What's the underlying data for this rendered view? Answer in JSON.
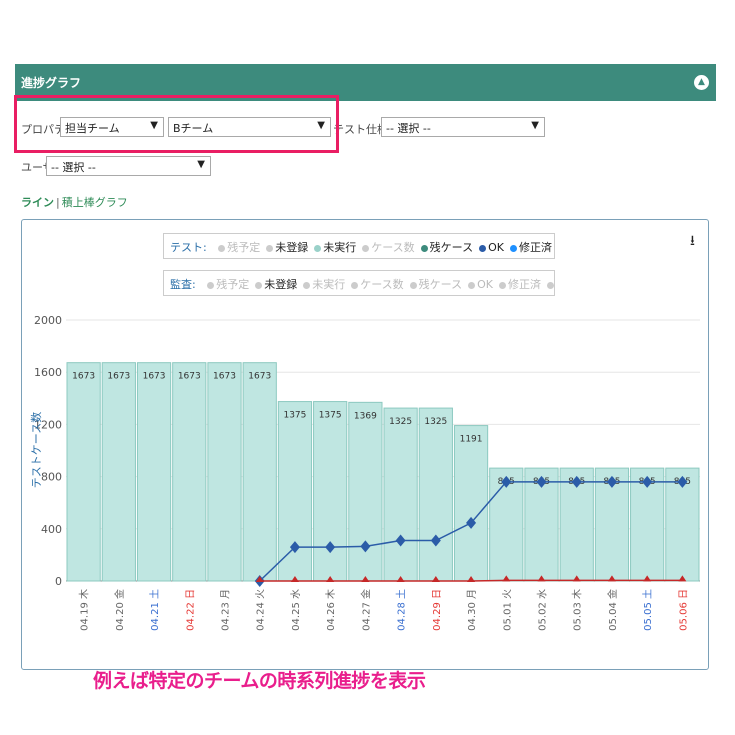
{
  "panel": {
    "title": "進捗グラフ",
    "collapse_icon": "chevron-up-icon"
  },
  "filters": {
    "property_label": "プロパティ",
    "property_value": "担当チーム",
    "team_value": "Bチーム",
    "spec_label": "テスト仕様書",
    "spec_value": "-- 選択 --",
    "user_label": "ユーザ",
    "user_value": "-- 選択 --"
  },
  "view_tabs": {
    "line": "ライン",
    "separator": "|",
    "stacked": "積上棒グラフ"
  },
  "legend": {
    "test": {
      "heading": "テスト:",
      "items": [
        {
          "label": "残予定",
          "active": false,
          "color": "#cccccc"
        },
        {
          "label": "未登録",
          "active": true,
          "color": "#cccccc"
        },
        {
          "label": "未実行",
          "active": true,
          "color": "#9ad1c9"
        },
        {
          "label": "ケース数",
          "active": false,
          "color": "#cccccc"
        },
        {
          "label": "残ケース",
          "active": true,
          "color": "#3d8b7d"
        },
        {
          "label": "OK",
          "active": true,
          "color": "#2b5ca8"
        },
        {
          "label": "修正済",
          "active": true,
          "color": "#1e90ff"
        },
        {
          "label": "NG",
          "active": true,
          "color": "#d32f2f"
        },
        {
          "label": "保留",
          "active": false,
          "color": "#cccccc"
        },
        {
          "label": "対象外",
          "active": false,
          "color": "#cccccc"
        }
      ]
    },
    "review": {
      "heading": "監査:",
      "items": [
        {
          "label": "残予定",
          "active": false,
          "color": "#cccccc"
        },
        {
          "label": "未登録",
          "active": true,
          "color": "#cccccc"
        },
        {
          "label": "未実行",
          "active": false,
          "color": "#cccccc"
        },
        {
          "label": "ケース数",
          "active": false,
          "color": "#cccccc"
        },
        {
          "label": "残ケース",
          "active": false,
          "color": "#cccccc"
        },
        {
          "label": "OK",
          "active": false,
          "color": "#cccccc"
        },
        {
          "label": "修正済",
          "active": false,
          "color": "#cccccc"
        },
        {
          "label": "NG",
          "active": false,
          "color": "#cccccc"
        },
        {
          "label": "保留",
          "active": false,
          "color": "#cccccc"
        },
        {
          "label": "対象外",
          "active": false,
          "color": "#cccccc"
        }
      ]
    }
  },
  "chart_data": {
    "type": "bar",
    "ylabel": "テストケース数",
    "ylim": [
      0,
      2000
    ],
    "yticks": [
      0,
      400,
      800,
      1200,
      1600,
      2000
    ],
    "grid": true,
    "categories": [
      {
        "label": "04.19 木",
        "color": "#666666"
      },
      {
        "label": "04.20 金",
        "color": "#666666"
      },
      {
        "label": "04.21 土",
        "color": "#3a6fd0"
      },
      {
        "label": "04.22 日",
        "color": "#e53935"
      },
      {
        "label": "04.23 月",
        "color": "#666666"
      },
      {
        "label": "04.24 火",
        "color": "#666666"
      },
      {
        "label": "04.25 水",
        "color": "#666666"
      },
      {
        "label": "04.26 木",
        "color": "#666666"
      },
      {
        "label": "04.27 金",
        "color": "#666666"
      },
      {
        "label": "04.28 土",
        "color": "#3a6fd0"
      },
      {
        "label": "04.29 日",
        "color": "#e53935"
      },
      {
        "label": "04.30 月",
        "color": "#666666"
      },
      {
        "label": "05.01 火",
        "color": "#666666"
      },
      {
        "label": "05.02 水",
        "color": "#666666"
      },
      {
        "label": "05.03 木",
        "color": "#666666"
      },
      {
        "label": "05.04 金",
        "color": "#666666"
      },
      {
        "label": "05.05 土",
        "color": "#3a6fd0"
      },
      {
        "label": "05.06 日",
        "color": "#e53935"
      }
    ],
    "series": [
      {
        "name": "未実行",
        "type": "bar",
        "color": "#bfe6e1",
        "stroke": "#8cc9c0",
        "values": [
          1673,
          1673,
          1673,
          1673,
          1673,
          1673,
          1375,
          1375,
          1369,
          1325,
          1325,
          1191,
          865,
          865,
          865,
          865,
          865,
          865
        ],
        "labels": [
          "1673",
          "1673",
          "1673",
          "1673",
          "1673",
          "1673",
          "1375",
          "1375",
          "1369",
          "1325",
          "1325",
          "1191",
          "865",
          "865",
          "865",
          "865",
          "865",
          "865"
        ]
      },
      {
        "name": "OK",
        "type": "line",
        "color": "#2b5ca8",
        "values": [
          null,
          null,
          null,
          null,
          null,
          0,
          260,
          260,
          265,
          310,
          310,
          445,
          760,
          760,
          760,
          760,
          760,
          760
        ]
      },
      {
        "name": "NG",
        "type": "line",
        "color": "#c62828",
        "values": [
          null,
          null,
          null,
          null,
          null,
          0,
          0,
          0,
          0,
          0,
          0,
          0,
          5,
          5,
          5,
          5,
          5,
          5
        ]
      }
    ]
  },
  "caption": "例えば特定のチームの時系列進捗を表示"
}
